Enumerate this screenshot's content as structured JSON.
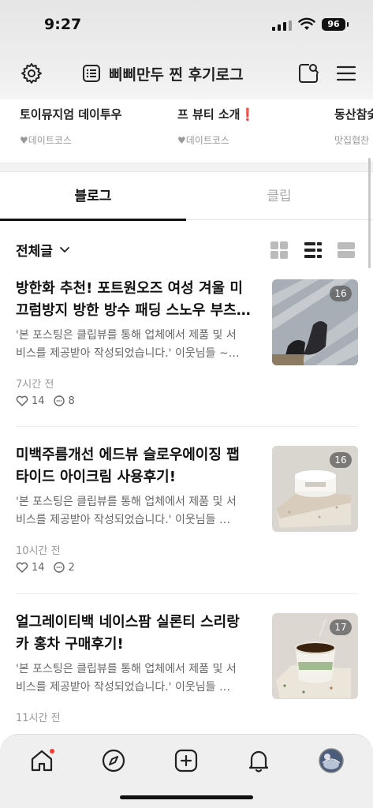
{
  "status_bar": {
    "time": "9:27",
    "battery": "96"
  },
  "header": {
    "blog_title": "삐삐만두 찐 후기로그",
    "icons": [
      "gear-icon",
      "list-doc-icon",
      "profile-search-icon",
      "menu-icon"
    ]
  },
  "featured": [
    {
      "title": "토이뮤지엄 데이투우",
      "category": "♥데이트코스"
    },
    {
      "title": "프 뷰티 소개",
      "excl": "❗",
      "category": "♥데이트코스"
    },
    {
      "title": "동산참숯",
      "category": "맛집협찬"
    }
  ],
  "tabs": [
    {
      "label": "블로그",
      "active": true
    },
    {
      "label": "클립",
      "active": false
    }
  ],
  "filter": {
    "label": "전체글",
    "views": [
      "grid-view-icon",
      "list-view-icon",
      "card-view-icon"
    ]
  },
  "posts": [
    {
      "title_line1": "방한화 추천! 포트원오즈 여성 겨울 미",
      "title_line2": "끄럼방지 방한 방수 패딩 스노우 부츠…",
      "excerpt_line1": "'본 포스팅은 클립뷰를 통해 업체에서 제품 및 서",
      "excerpt_line2": "비스를 제공받아 작성되었습니다.' 이웃님들 ~…",
      "time": "7시간 전",
      "likes": "14",
      "comments": "8",
      "image_count": "16",
      "thumb": "boots-photo"
    },
    {
      "title_line1": "미백주름개선 에드뷰 슬로우에이징 팹",
      "title_line2": "타이드 아이크림 사용후기!",
      "excerpt_line1": "'본 포스팅은 클립뷰를 통해 업체에서 제품 및 서",
      "excerpt_line2": "비스를 제공받아 작성되었습니다.' 이웃님들 …",
      "time": "10시간 전",
      "likes": "14",
      "comments": "2",
      "image_count": "16",
      "thumb": "cream-jar-photo"
    },
    {
      "title_line1": "얼그레이티백 네이스팜 실론티 스리랑",
      "title_line2": "카 홍차 구매후기!",
      "excerpt_line1": "'본 포스팅은 클립뷰를 통해 업체에서 제품 및 서",
      "excerpt_line2": "비스를 제공받아 작성되었습니다.' 이웃님들 …",
      "time": "11시간 전",
      "image_count": "17",
      "thumb": "tea-cup-photo"
    }
  ],
  "bottom_nav": [
    "home-icon",
    "explore-icon",
    "add-post-icon",
    "notification-icon",
    "profile-avatar"
  ]
}
